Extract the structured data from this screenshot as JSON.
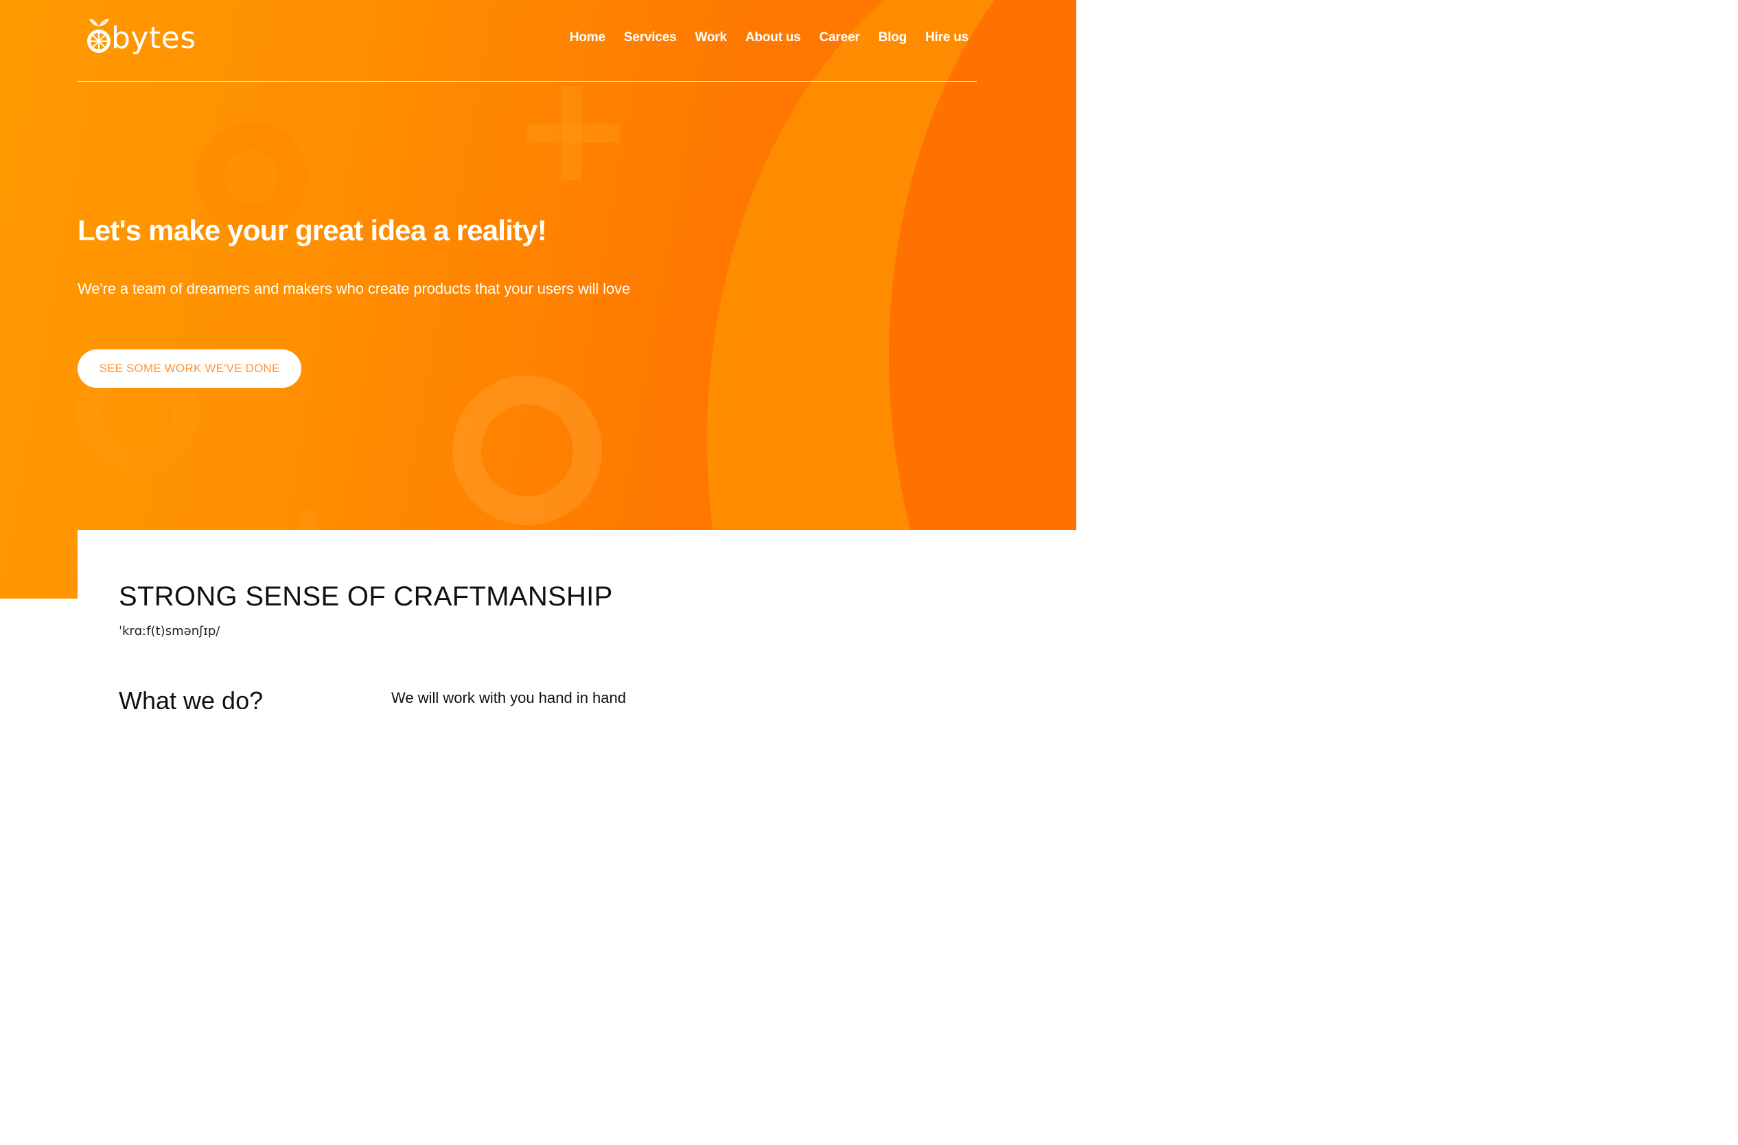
{
  "brand": {
    "name": "bytes",
    "accent": "#ff8a00",
    "gradient_start": "#ff9a00",
    "gradient_end": "#ff6a00",
    "cta_text_color": "#ff9433"
  },
  "nav": {
    "items": [
      {
        "label": "Home"
      },
      {
        "label": "Services"
      },
      {
        "label": "Work"
      },
      {
        "label": "About us"
      },
      {
        "label": "Career"
      },
      {
        "label": "Blog"
      },
      {
        "label": "Hire us"
      }
    ]
  },
  "hero": {
    "title": "Let's make your great idea a reality!",
    "subtitle": "We're a team of dreamers and makers who create products that your users will love",
    "cta_label": "SEE SOME WORK WE'VE DONE"
  },
  "section": {
    "title": "STRONG SENSE OF CRAFTMANSHIP",
    "phonetic": "ˈkrɑːf(t)smənʃɪp/",
    "what_title": "What we do?",
    "what_text": "We will work with you hand in hand"
  },
  "icons": {
    "logo": "orange-slice-icon",
    "decor": [
      "ring-decor-icon",
      "plus-decor-icon"
    ]
  }
}
